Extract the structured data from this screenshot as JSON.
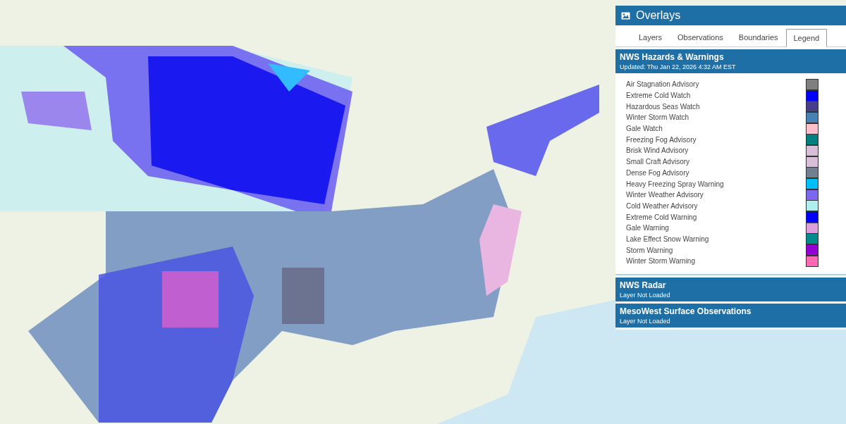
{
  "panel": {
    "title": "Overlays",
    "tabs": [
      {
        "label": "Layers",
        "selected": false
      },
      {
        "label": "Observations",
        "selected": false
      },
      {
        "label": "Boundaries",
        "selected": false
      },
      {
        "label": "Legend",
        "selected": true
      }
    ],
    "sections": [
      {
        "title": "NWS Hazards & Warnings",
        "subtitle": "Updated: Thu Jan 22, 2026 4:32 AM EST",
        "legend": [
          {
            "label": "Air Stagnation Advisory",
            "color": "#808080"
          },
          {
            "label": "Extreme Cold Watch",
            "color": "#0000ff"
          },
          {
            "label": "Hazardous Seas Watch",
            "color": "#483d8b"
          },
          {
            "label": "Winter Storm Watch",
            "color": "#4682b4"
          },
          {
            "label": "Gale Watch",
            "color": "#ffc0cb"
          },
          {
            "label": "Freezing Fog Advisory",
            "color": "#008080"
          },
          {
            "label": "Brisk Wind Advisory",
            "color": "#d8bfd8"
          },
          {
            "label": "Small Craft Advisory",
            "color": "#d8bfd7"
          },
          {
            "label": "Dense Fog Advisory",
            "color": "#708090"
          },
          {
            "label": "Heavy Freezing Spray Warning",
            "color": "#00bfff"
          },
          {
            "label": "Winter Weather Advisory",
            "color": "#7b68ee"
          },
          {
            "label": "Cold Weather Advisory",
            "color": "#afeeee"
          },
          {
            "label": "Extreme Cold Warning",
            "color": "#0000fe"
          },
          {
            "label": "Gale Warning",
            "color": "#dda0dd"
          },
          {
            "label": "Lake Effect Snow Warning",
            "color": "#008b8b"
          },
          {
            "label": "Storm Warning",
            "color": "#9400d3"
          },
          {
            "label": "Winter Storm Warning",
            "color": "#ff69b4"
          }
        ]
      },
      {
        "title": "NWS Radar",
        "subtitle": "Layer Not Loaded"
      },
      {
        "title": "MesoWest Surface Observations",
        "subtitle": "Layer Not Loaded"
      }
    ]
  }
}
